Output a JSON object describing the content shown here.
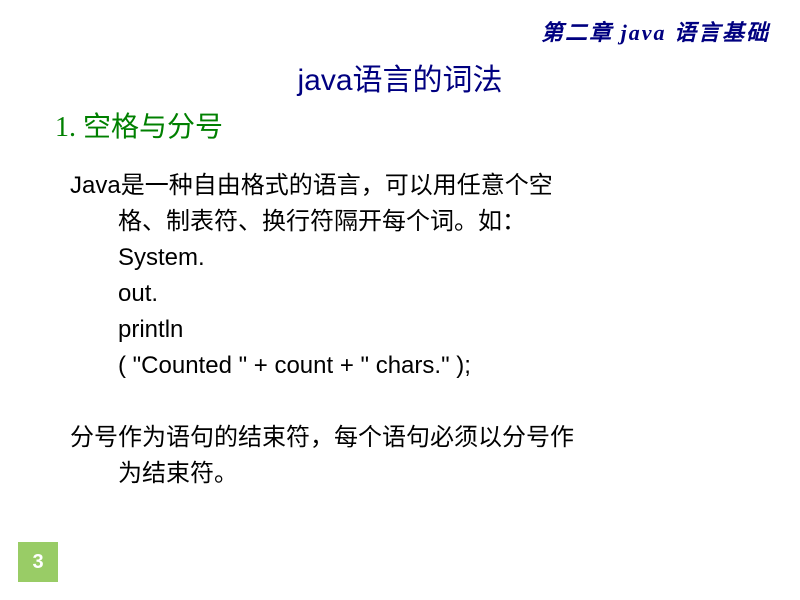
{
  "chapter": "第二章  java 语言基础",
  "title": "java语言的词法",
  "section": "1. 空格与分号",
  "paragraph1_line1": "Java是一种自由格式的语言，可以用任意个空",
  "paragraph1_line2": "格、制表符、换行符隔开每个词。如：",
  "code": {
    "line1": "System.",
    "line2": "out.",
    "line3": "println",
    "line4": "( \"Counted \" + count + \" chars.\" );"
  },
  "paragraph2_line1": "分号作为语句的结束符，每个语句必须以分号作",
  "paragraph2_line2": "为结束符。",
  "pageNumber": "3"
}
